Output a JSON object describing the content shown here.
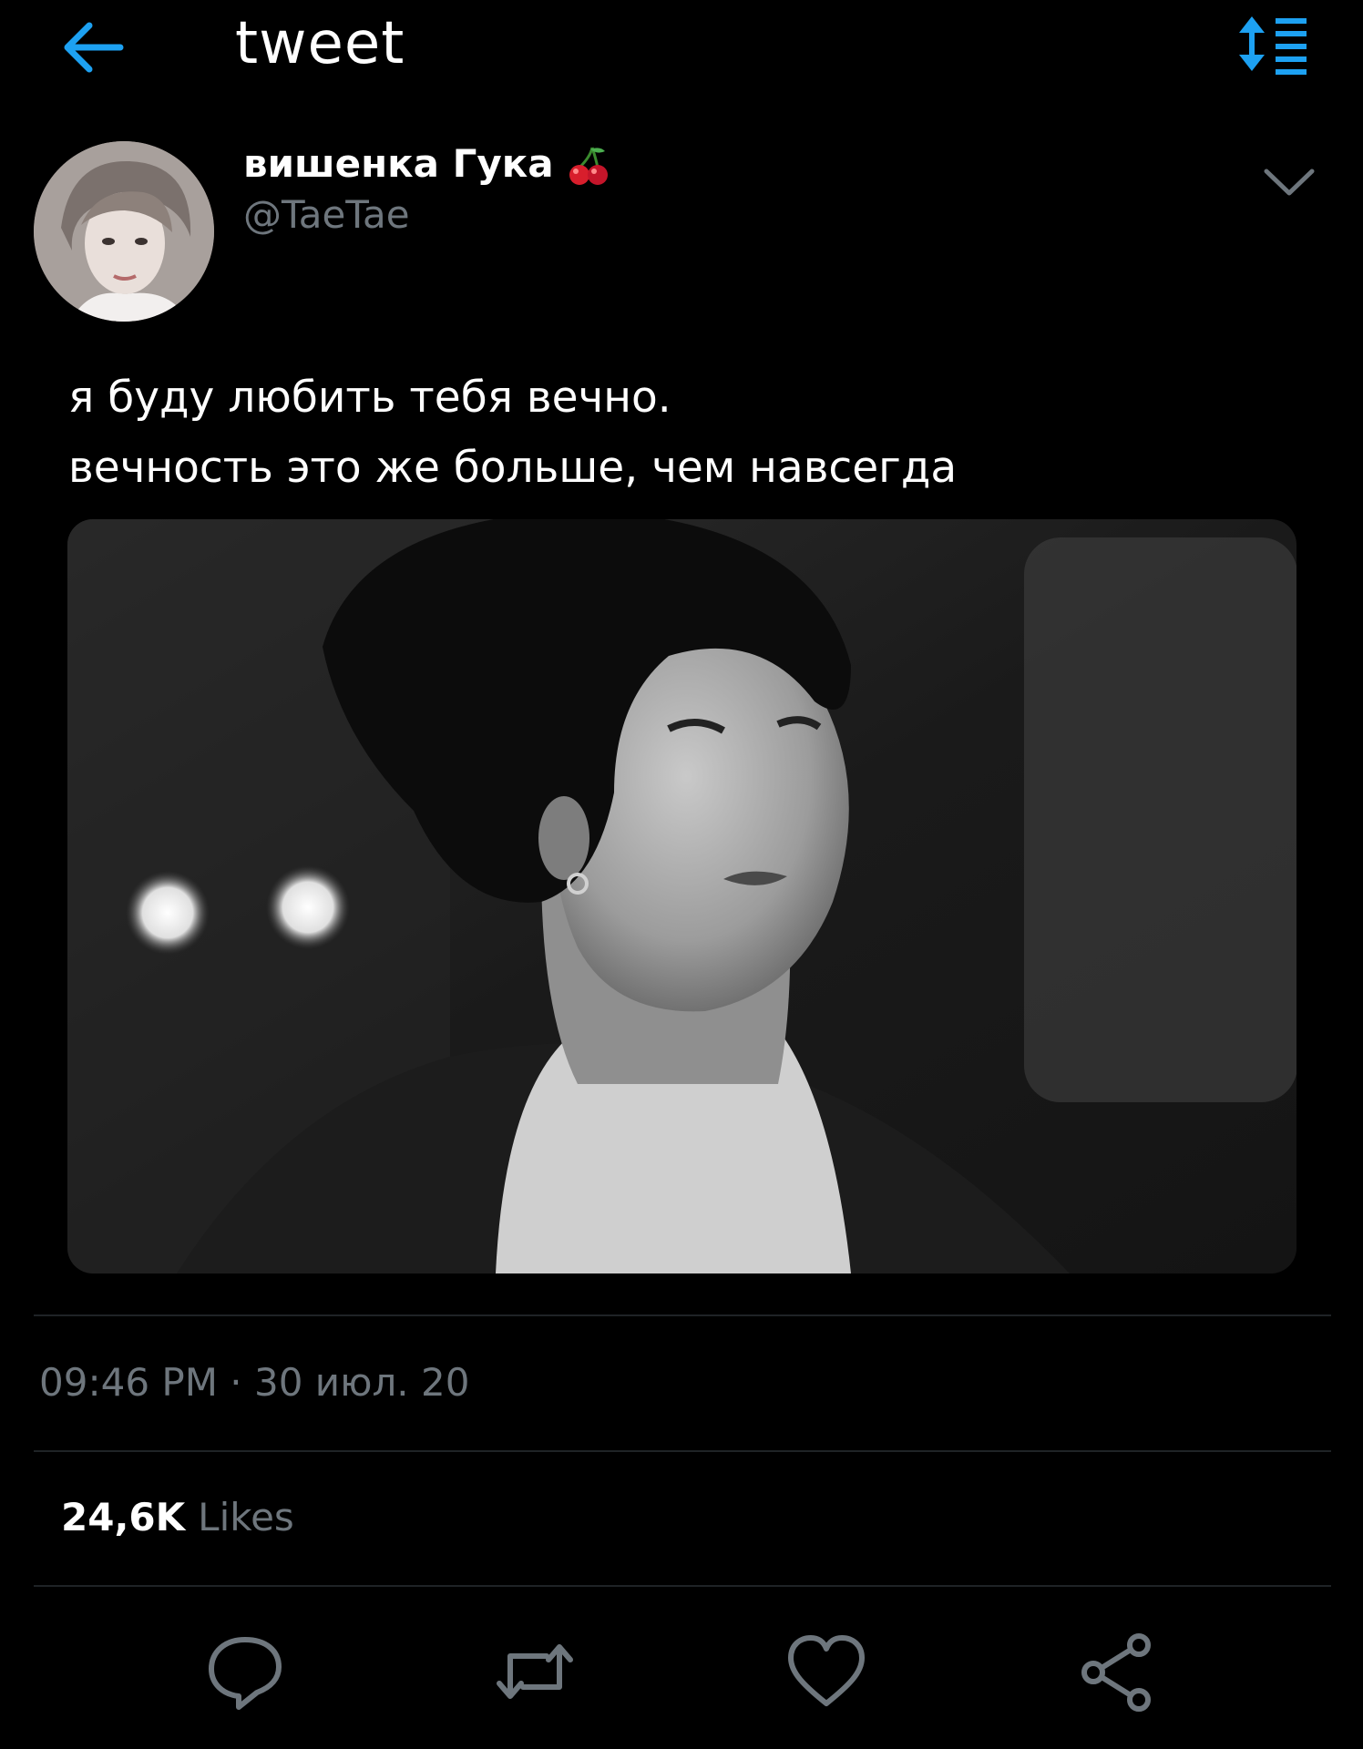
{
  "header": {
    "title": "tweet",
    "back_icon": "arrow-left-icon",
    "sort_icon": "sort-list-icon"
  },
  "author": {
    "name": "вишенка Гука",
    "name_emoji": "cherry-icon",
    "handle": "@TaeTae",
    "menu_icon": "chevron-down-icon"
  },
  "tweet": {
    "lines": [
      "я буду любить тебя вечно.",
      "вечность это же больше, чем навсегда"
    ],
    "media_description_icon": "photo"
  },
  "meta": {
    "timestamp": "09:46 PM · 30 июл. 20"
  },
  "stats": {
    "likes_count": "24,6K",
    "likes_label": "Likes"
  },
  "actions": {
    "reply_icon": "reply-icon",
    "retweet_icon": "retweet-icon",
    "like_icon": "heart-icon",
    "share_icon": "share-icon"
  },
  "colors": {
    "background": "#000000",
    "accent": "#1da1f2",
    "secondary_text": "#6e767d",
    "divider": "#1f2326"
  }
}
